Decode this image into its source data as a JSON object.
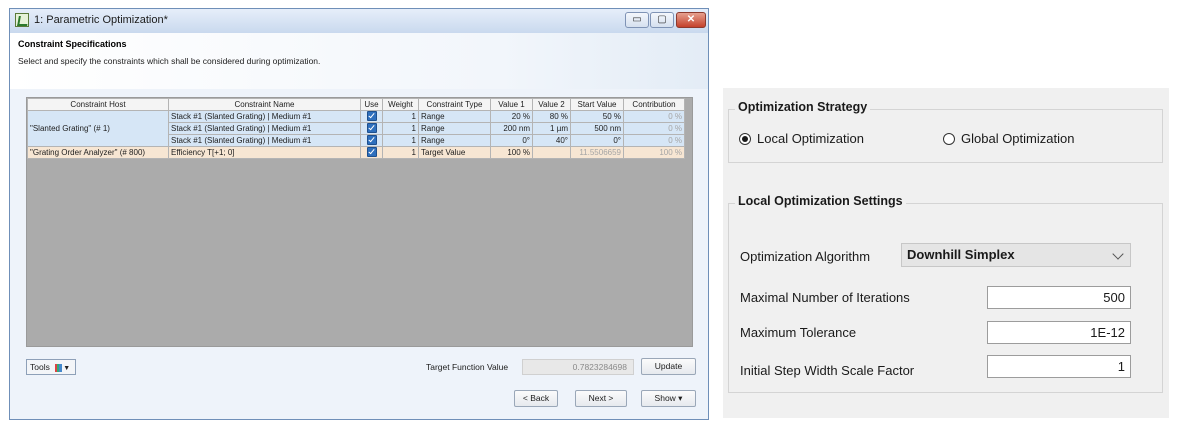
{
  "window": {
    "title": "1: Parametric Optimization*",
    "header_title": "Constraint Specifications",
    "header_subtitle": "Select and specify the constraints which shall be considered during optimization.",
    "controls": {
      "minimize": "▭",
      "maximize": "▢",
      "close": "✕"
    }
  },
  "table": {
    "columns": [
      "Constraint Host",
      "Constraint Name",
      "Use",
      "Weight",
      "Constraint Type",
      "Value 1",
      "Value 2",
      "Start Value",
      "Contribution"
    ],
    "rows": [
      {
        "host": "\"Slanted Grating\" (# 1)",
        "name": "Stack #1 (Slanted Grating) | Medium #1",
        "use": true,
        "weight": "1",
        "type": "Range",
        "value1": "20 %",
        "value2": "80 %",
        "start": "50 %",
        "contribution": "0 %"
      },
      {
        "host": "",
        "name": "Stack #1 (Slanted Grating) | Medium #1",
        "use": true,
        "weight": "1",
        "type": "Range",
        "value1": "200 nm",
        "value2": "1 µm",
        "start": "500 nm",
        "contribution": "0 %"
      },
      {
        "host": "",
        "name": "Stack #1 (Slanted Grating) | Medium #1",
        "use": true,
        "weight": "1",
        "type": "Range",
        "value1": "0°",
        "value2": "40°",
        "start": "0°",
        "contribution": "0 %"
      },
      {
        "host": "\"Grating Order Analyzer\" (# 800)",
        "name": "Efficiency T[+1; 0]",
        "use": true,
        "weight": "1",
        "type": "Target Value",
        "value1": "100 %",
        "value2": "",
        "start": "11.5506659",
        "contribution": "100 %"
      }
    ]
  },
  "footer": {
    "tools_label": "Tools",
    "target_function_label": "Target Function Value",
    "target_function_value": "0.7823284698",
    "update_label": "Update",
    "back_label": "< Back",
    "next_label": "Next >",
    "show_label": "Show ▾"
  },
  "strategy": {
    "group_label": "Optimization Strategy",
    "options": [
      "Local Optimization",
      "Global Optimization"
    ],
    "selected": "Local Optimization"
  },
  "local_settings": {
    "group_label": "Local Optimization Settings",
    "algorithm_label": "Optimization Algorithm",
    "algorithm_value": "Downhill Simplex",
    "max_iterations_label": "Maximal Number of Iterations",
    "max_iterations_value": "500",
    "tolerance_label": "Maximum Tolerance",
    "tolerance_value": "1E-12",
    "step_width_label": "Initial Step Width Scale Factor",
    "step_width_value": "1"
  },
  "colors": {
    "row_blue": "#d6e6f6",
    "row_orange": "#f7e6d3",
    "grid_background": "#ababab",
    "checkbox": "#2e6fbd"
  },
  "icons": [
    "app-icon",
    "minimize-icon",
    "maximize-icon",
    "close-icon",
    "tools-icon",
    "chevron-down-icon",
    "checkbox-checked-icon"
  ]
}
